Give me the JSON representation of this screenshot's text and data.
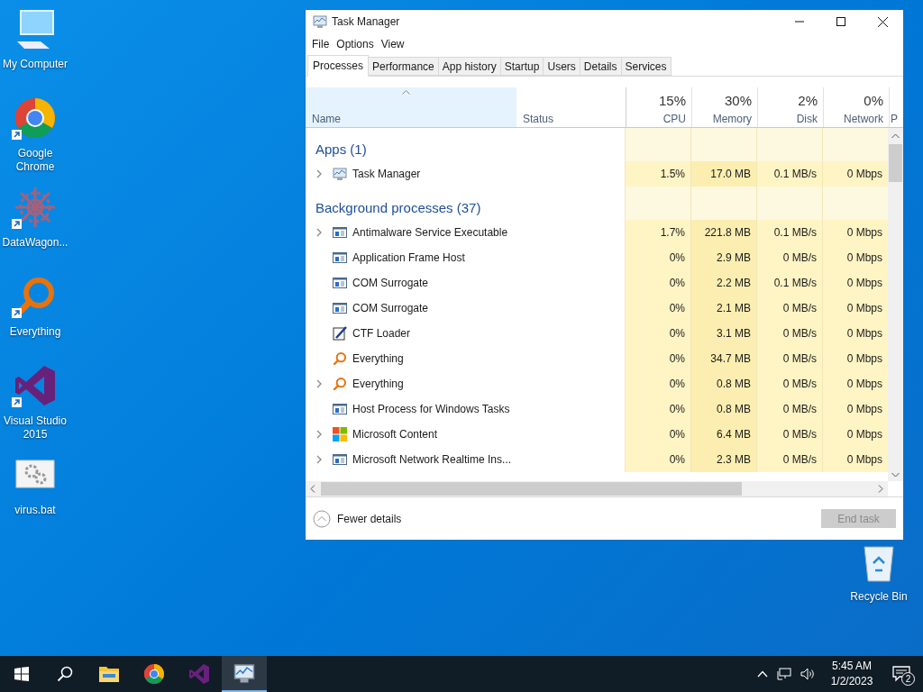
{
  "desktop_icons": [
    {
      "label": "My Computer",
      "kind": "computer",
      "shortcut": false
    },
    {
      "label": "Google Chrome",
      "kind": "chrome",
      "shortcut": true
    },
    {
      "label": "DataWagon...",
      "kind": "datawagon",
      "shortcut": true
    },
    {
      "label": "Everything",
      "kind": "everything",
      "shortcut": true
    },
    {
      "label": "Visual Studio 2015",
      "kind": "vs",
      "shortcut": true
    },
    {
      "label": "virus.bat",
      "kind": "bat",
      "shortcut": false
    }
  ],
  "recycle_bin": {
    "label": "Recycle Bin"
  },
  "window": {
    "title": "Task Manager",
    "menu": [
      "File",
      "Options",
      "View"
    ],
    "tabs": [
      {
        "label": "Processes",
        "selected": true
      },
      {
        "label": "Performance",
        "selected": false
      },
      {
        "label": "App history",
        "selected": false
      },
      {
        "label": "Startup",
        "selected": false
      },
      {
        "label": "Users",
        "selected": false
      },
      {
        "label": "Details",
        "selected": false
      },
      {
        "label": "Services",
        "selected": false
      }
    ],
    "columns": [
      {
        "label": "Name",
        "sorted": true
      },
      {
        "label": "Status",
        "sorted": false
      },
      {
        "percent": "15%",
        "label": "CPU",
        "sorted": false
      },
      {
        "percent": "30%",
        "label": "Memory",
        "sorted": false
      },
      {
        "percent": "2%",
        "label": "Disk",
        "sorted": false
      },
      {
        "percent": "0%",
        "label": "Network",
        "sorted": false
      },
      {
        "label": "P",
        "sorted": false
      }
    ],
    "groups": [
      {
        "title": "Apps (1)",
        "rows": [
          {
            "name": "Task Manager",
            "kind": "taskmgr",
            "expandable": true,
            "values": [
              "1.5%",
              "17.0 MB",
              "0.1 MB/s",
              "0 Mbps"
            ]
          }
        ]
      },
      {
        "title": "Background processes (37)",
        "rows": [
          {
            "name": "Antimalware Service Executable",
            "kind": "window",
            "expandable": true,
            "values": [
              "1.7%",
              "221.8 MB",
              "0.1 MB/s",
              "0 Mbps"
            ]
          },
          {
            "name": "Application Frame Host",
            "kind": "window",
            "expandable": false,
            "values": [
              "0%",
              "2.9 MB",
              "0 MB/s",
              "0 Mbps"
            ]
          },
          {
            "name": "COM Surrogate",
            "kind": "window",
            "expandable": false,
            "values": [
              "0%",
              "2.2 MB",
              "0.1 MB/s",
              "0 Mbps"
            ]
          },
          {
            "name": "COM Surrogate",
            "kind": "window",
            "expandable": false,
            "values": [
              "0%",
              "2.1 MB",
              "0 MB/s",
              "0 Mbps"
            ]
          },
          {
            "name": "CTF Loader",
            "kind": "ctf",
            "expandable": false,
            "values": [
              "0%",
              "3.1 MB",
              "0 MB/s",
              "0 Mbps"
            ]
          },
          {
            "name": "Everything",
            "kind": "everything",
            "expandable": false,
            "values": [
              "0%",
              "34.7 MB",
              "0 MB/s",
              "0 Mbps"
            ]
          },
          {
            "name": "Everything",
            "kind": "everything",
            "expandable": true,
            "values": [
              "0%",
              "0.8 MB",
              "0 MB/s",
              "0 Mbps"
            ]
          },
          {
            "name": "Host Process for Windows Tasks",
            "kind": "window",
            "expandable": false,
            "values": [
              "0%",
              "0.8 MB",
              "0 MB/s",
              "0 Mbps"
            ]
          },
          {
            "name": "Microsoft Content",
            "kind": "mscontent",
            "expandable": true,
            "values": [
              "0%",
              "6.4 MB",
              "0 MB/s",
              "0 Mbps"
            ]
          },
          {
            "name": "Microsoft Network Realtime Ins...",
            "kind": "window",
            "expandable": true,
            "values": [
              "0%",
              "2.3 MB",
              "0 MB/s",
              "0 Mbps"
            ]
          }
        ]
      }
    ],
    "footer": {
      "toggle": "Fewer details",
      "end_task": {
        "label": "End task",
        "disabled": true
      }
    }
  },
  "taskbar": {
    "apps": [
      {
        "kind": "explorer",
        "active": false
      },
      {
        "kind": "chrome",
        "active": false
      },
      {
        "kind": "vs",
        "active": false
      },
      {
        "kind": "taskmgr",
        "active": true
      }
    ],
    "time": "5:45 AM",
    "date": "1/2/2023",
    "notifications": "2"
  }
}
